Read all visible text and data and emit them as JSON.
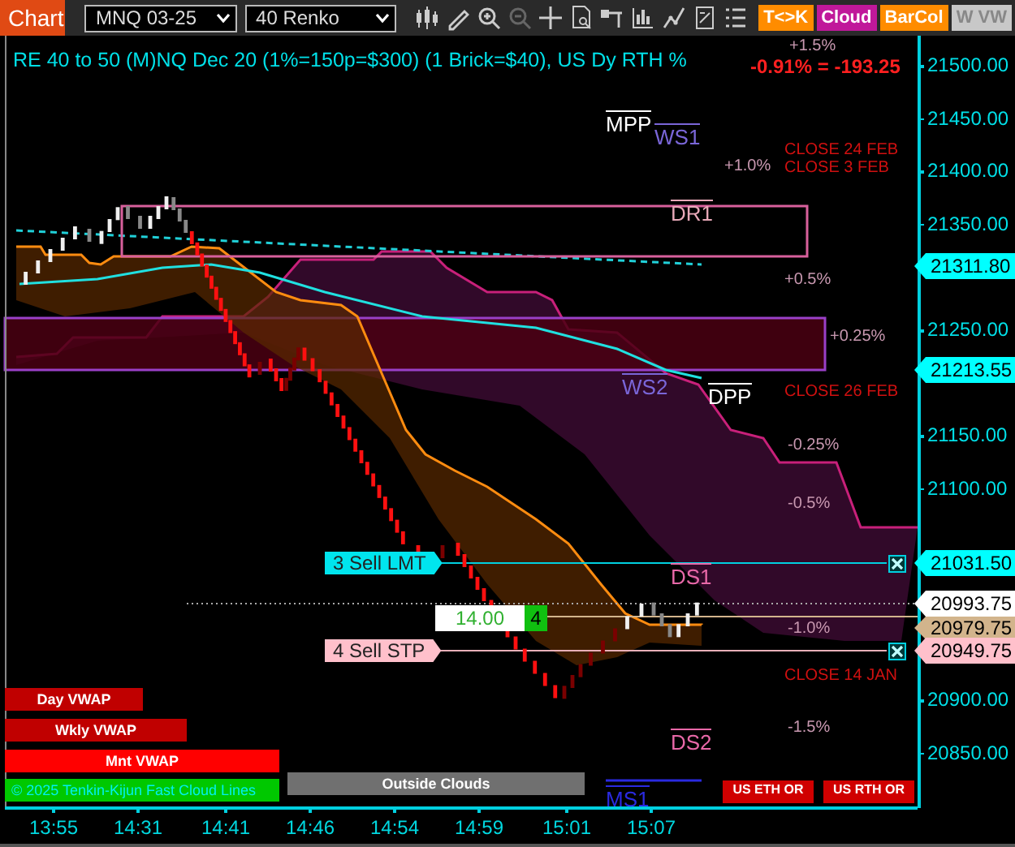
{
  "toolbar": {
    "title": "Chart",
    "instrument": "MNQ 03-25",
    "bar_type": "40 Renko",
    "toggles": [
      {
        "label": "T<>K",
        "color": "#ff8c00"
      },
      {
        "label": "Cloud",
        "color": "#c0189a"
      },
      {
        "label": "BarCol",
        "color": "#ff8c00"
      },
      {
        "label": "W VW",
        "color": "#c8c8c8"
      }
    ]
  },
  "chart": {
    "heading": "RE 40 to 50 (M)NQ Dec 20 (1%=150p=$300) (1 Brick=$40), US Dy RTH %",
    "change": "-0.91% = -193.25",
    "pivot_labels": [
      {
        "text": "MPP",
        "color": "#ffffff"
      },
      {
        "text": "WS1",
        "color": "#7a66d8"
      },
      {
        "text": "DR1",
        "color": "#e8a8b8"
      },
      {
        "text": "DPP",
        "color": "#ffffff"
      },
      {
        "text": "WS2",
        "color": "#7a66d8"
      },
      {
        "text": "DS1",
        "color": "#e868a8"
      },
      {
        "text": "DS2",
        "color": "#e868a8"
      },
      {
        "text": "MS1",
        "color": "#2a2ae0"
      }
    ],
    "close_labels": [
      "CLOSE 24 FEB",
      "CLOSE 3 FEB",
      "CLOSE 26 FEB",
      "CLOSE 14 JAN"
    ],
    "percent_labels": [
      "+1.5%",
      "+1.0%",
      "+0.5%",
      "+0.25%",
      "-0.25%",
      "-0.5%",
      "-1.0%",
      "-1.5%"
    ],
    "orders": [
      {
        "label": "3 Sell LMT",
        "color": "#00e5ee"
      },
      {
        "label": "4 Sell STP",
        "color": "#ffc0cb"
      }
    ],
    "position": {
      "pnl": "14.00",
      "quantity": "4"
    },
    "price_axis": [
      "21500.00",
      "21450.00",
      "21400.00",
      "21350.00",
      "21250.00",
      "21150.00",
      "21100.00",
      "20900.00",
      "20850.00"
    ],
    "price_tags": [
      {
        "price": "21311.80",
        "color": "#00ffff"
      },
      {
        "price": "21213.55",
        "color": "#00ffff"
      },
      {
        "price": "21031.50",
        "color": "#00ffff"
      },
      {
        "price": "20993.75",
        "color": "#ffffff"
      },
      {
        "price": "20979.75",
        "color": "#d2b48c"
      },
      {
        "price": "20949.75",
        "color": "#ffc0cb"
      }
    ],
    "legend": [
      {
        "text": "Day VWAP",
        "color": "#c00000"
      },
      {
        "text": "Wkly VWAP",
        "color": "#c00000"
      },
      {
        "text": "Mnt VWAP",
        "color": "#ff0000"
      },
      {
        "text": "© 2025 Tenkin-Kijun Fast Cloud Lines",
        "color": "#00c800"
      },
      {
        "text": "Outside Clouds",
        "color": "#707070"
      }
    ],
    "session_boxes": [
      "US ETH OR",
      "US RTH OR"
    ],
    "time_axis": [
      "13:55",
      "14:31",
      "14:41",
      "14:46",
      "14:54",
      "14:59",
      "15:01",
      "15:07"
    ]
  }
}
